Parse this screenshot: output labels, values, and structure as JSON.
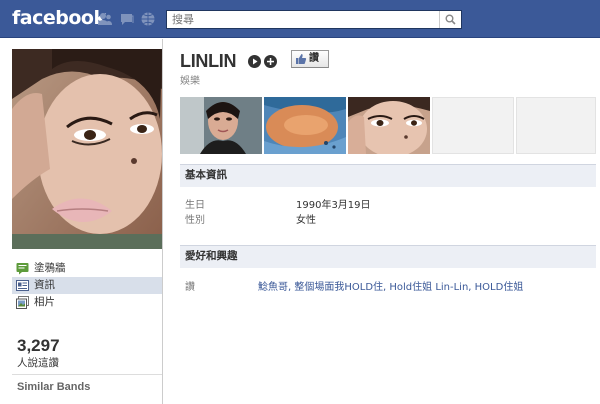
{
  "brand": {
    "logo_text": "facebook",
    "color": "#3b5998"
  },
  "topbar": {
    "icons": [
      "friend-requests-icon",
      "messages-icon",
      "notifications-icon"
    ],
    "search_placeholder": "搜尋"
  },
  "profile": {
    "name": "LINLIN",
    "category": "娛樂",
    "like_button": "讚"
  },
  "nav": [
    {
      "label": "塗鴉牆",
      "icon": "wall-icon",
      "selected": false
    },
    {
      "label": "資訊",
      "icon": "info-icon",
      "selected": true
    },
    {
      "label": "相片",
      "icon": "photos-icon",
      "selected": false
    }
  ],
  "likes": {
    "count": "3,297",
    "label": "人說這讚"
  },
  "similar_heading": "Similar Bands",
  "basic_info": {
    "heading": "基本資訊",
    "rows": [
      {
        "label": "生日",
        "value": "1990年3月19日"
      },
      {
        "label": "性別",
        "value": "女性"
      }
    ]
  },
  "interests": {
    "heading": "愛好和興趣",
    "rows": [
      {
        "label": "讚",
        "value": "鯰魚哥, 整個場面我HOLD住, Hold住姐 Lin-Lin, HOLD住姐"
      }
    ]
  }
}
